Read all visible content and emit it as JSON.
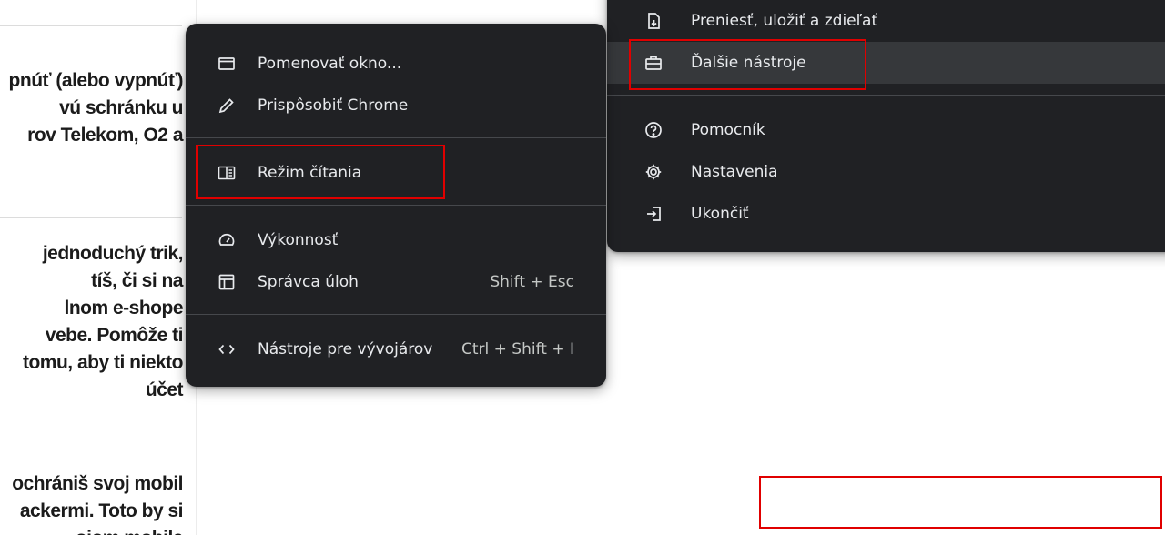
{
  "article": {
    "blocks": [
      {
        "lines": [
          "pnúť (alebo vypnúť)",
          "vú schránku u",
          "rov Telekom, O2 a"
        ]
      },
      {
        "lines": [
          "jednoduchý trik,",
          "tíš, či si na",
          "lnom e-shope",
          "vebe. Pomôže ti",
          "tomu, aby ti niekto",
          "účet"
        ]
      },
      {
        "lines": [
          "ochrániš svoj mobil",
          "ackermi. Toto by si",
          "ojom mobile"
        ]
      }
    ]
  },
  "main_menu": {
    "items": [
      {
        "label": "Preniesť, uložiť a zdieľať",
        "icon": "save-share-icon"
      },
      {
        "label": "Ďalšie nástroje",
        "icon": "toolbox-icon"
      },
      {
        "label": "Pomocník",
        "icon": "help-icon"
      },
      {
        "label": "Nastavenia",
        "icon": "settings-gear-icon"
      },
      {
        "label": "Ukončiť",
        "icon": "exit-icon"
      }
    ]
  },
  "sub_menu": {
    "items": [
      {
        "label": "Pomenovať okno...",
        "icon": "window-icon",
        "shortcut": ""
      },
      {
        "label": "Prispôsobiť Chrome",
        "icon": "pencil-icon",
        "shortcut": ""
      },
      {
        "label": "Režim čítania",
        "icon": "reading-mode-icon",
        "shortcut": ""
      },
      {
        "label": "Výkonnosť",
        "icon": "performance-gauge-icon",
        "shortcut": ""
      },
      {
        "label": "Správca úloh",
        "icon": "task-manager-icon",
        "shortcut": "Shift + Esc"
      },
      {
        "label": "Nástroje pre vývojárov",
        "icon": "developer-tools-icon",
        "shortcut": "Ctrl + Shift + I"
      }
    ]
  },
  "colors": {
    "menu_background": "#202124",
    "menu_text": "#e8eaed",
    "hover_background": "#36383b",
    "highlight_border": "#e00000"
  }
}
